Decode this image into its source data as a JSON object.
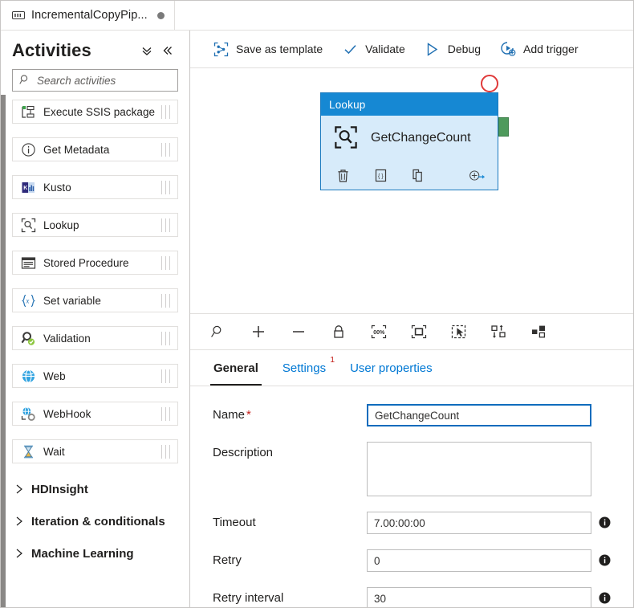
{
  "window": {
    "tab_title": "IncrementalCopyPip...",
    "tab_icon": "pipeline-icon",
    "unsaved_indicator": "dirty-dot"
  },
  "sidebar": {
    "title": "Activities",
    "collapse_all_icon": "double-chevron-down-icon",
    "collapse_panel_icon": "double-chevron-left-icon",
    "search": {
      "placeholder": "Search activities",
      "value": "",
      "icon": "search-icon"
    },
    "items": [
      {
        "label": "Execute SSIS package",
        "icon": "ssis-package-icon"
      },
      {
        "label": "Get Metadata",
        "icon": "info-circle-icon"
      },
      {
        "label": "Kusto",
        "icon": "kusto-icon"
      },
      {
        "label": "Lookup",
        "icon": "lookup-icon"
      },
      {
        "label": "Stored Procedure",
        "icon": "stored-procedure-icon"
      },
      {
        "label": "Set variable",
        "icon": "set-variable-icon"
      },
      {
        "label": "Validation",
        "icon": "validation-icon"
      },
      {
        "label": "Web",
        "icon": "web-icon"
      },
      {
        "label": "WebHook",
        "icon": "webhook-icon"
      },
      {
        "label": "Wait",
        "icon": "hourglass-icon"
      }
    ],
    "groups": [
      {
        "label": "HDInsight",
        "expanded": false
      },
      {
        "label": "Iteration & conditionals",
        "expanded": false
      },
      {
        "label": "Machine Learning",
        "expanded": false
      }
    ]
  },
  "commandbar": {
    "buttons": [
      {
        "label": "Save as template",
        "icon": "template-icon"
      },
      {
        "label": "Validate",
        "icon": "checkmark-icon"
      },
      {
        "label": "Debug",
        "icon": "play-triangle-icon"
      },
      {
        "label": "Add trigger",
        "icon": "add-trigger-icon"
      }
    ]
  },
  "canvas": {
    "node": {
      "type_label": "Lookup",
      "name": "GetChangeCount",
      "activity_icon": "lookup-icon",
      "has_error": true,
      "error_marker": "red-circle",
      "output_port": "success-port",
      "actions": [
        {
          "name": "delete-activity",
          "icon": "trash-icon"
        },
        {
          "name": "view-code",
          "icon": "code-braces-icon"
        },
        {
          "name": "clone-activity",
          "icon": "copy-icon"
        },
        {
          "name": "add-output",
          "icon": "add-output-arrow-icon"
        }
      ]
    },
    "header_color": "#1688d3",
    "body_color": "#d7ebfa",
    "border_color": "#1d7bbf",
    "error_color": "#e03a3a",
    "port_color": "#4e9a5c"
  },
  "canvas_toolbar": {
    "buttons": [
      {
        "name": "zoom-search-icon",
        "title": "Zoom"
      },
      {
        "name": "zoom-in-icon",
        "title": "Zoom in"
      },
      {
        "name": "zoom-out-icon",
        "title": "Zoom out"
      },
      {
        "name": "lock-icon",
        "title": "Lock canvas"
      },
      {
        "name": "zoom-100-icon",
        "title": "Zoom to 100%"
      },
      {
        "name": "zoom-to-fit-icon",
        "title": "Zoom to fit"
      },
      {
        "name": "select-all-icon",
        "title": "Select all"
      },
      {
        "name": "auto-align-icon",
        "title": "Auto align"
      },
      {
        "name": "layout-icon",
        "title": "Layout"
      }
    ]
  },
  "property_tabs": [
    {
      "label": "General",
      "active": true,
      "badge": ""
    },
    {
      "label": "Settings",
      "active": false,
      "badge": "1"
    },
    {
      "label": "User properties",
      "active": false,
      "badge": ""
    }
  ],
  "form": {
    "fields": [
      {
        "label": "Name",
        "required": true,
        "value": "GetChangeCount",
        "type": "text",
        "focused": true,
        "info": false
      },
      {
        "label": "Description",
        "required": false,
        "value": "",
        "type": "textarea",
        "focused": false,
        "info": false
      },
      {
        "label": "Timeout",
        "required": false,
        "value": "7.00:00:00",
        "type": "text",
        "focused": false,
        "info": true
      },
      {
        "label": "Retry",
        "required": false,
        "value": "0",
        "type": "text",
        "focused": false,
        "info": true
      },
      {
        "label": "Retry interval",
        "required": false,
        "value": "30",
        "type": "text",
        "focused": false,
        "info": true
      }
    ],
    "required_marker": "*",
    "info_icon": "info-icon"
  },
  "colors": {
    "accent": "#0078d4",
    "link": "#0078d4",
    "required": "#c5211c",
    "node_header": "#1688d3",
    "node_body": "#d7ebfa",
    "port_green": "#4e9a5c",
    "error_red": "#e03a3a"
  }
}
